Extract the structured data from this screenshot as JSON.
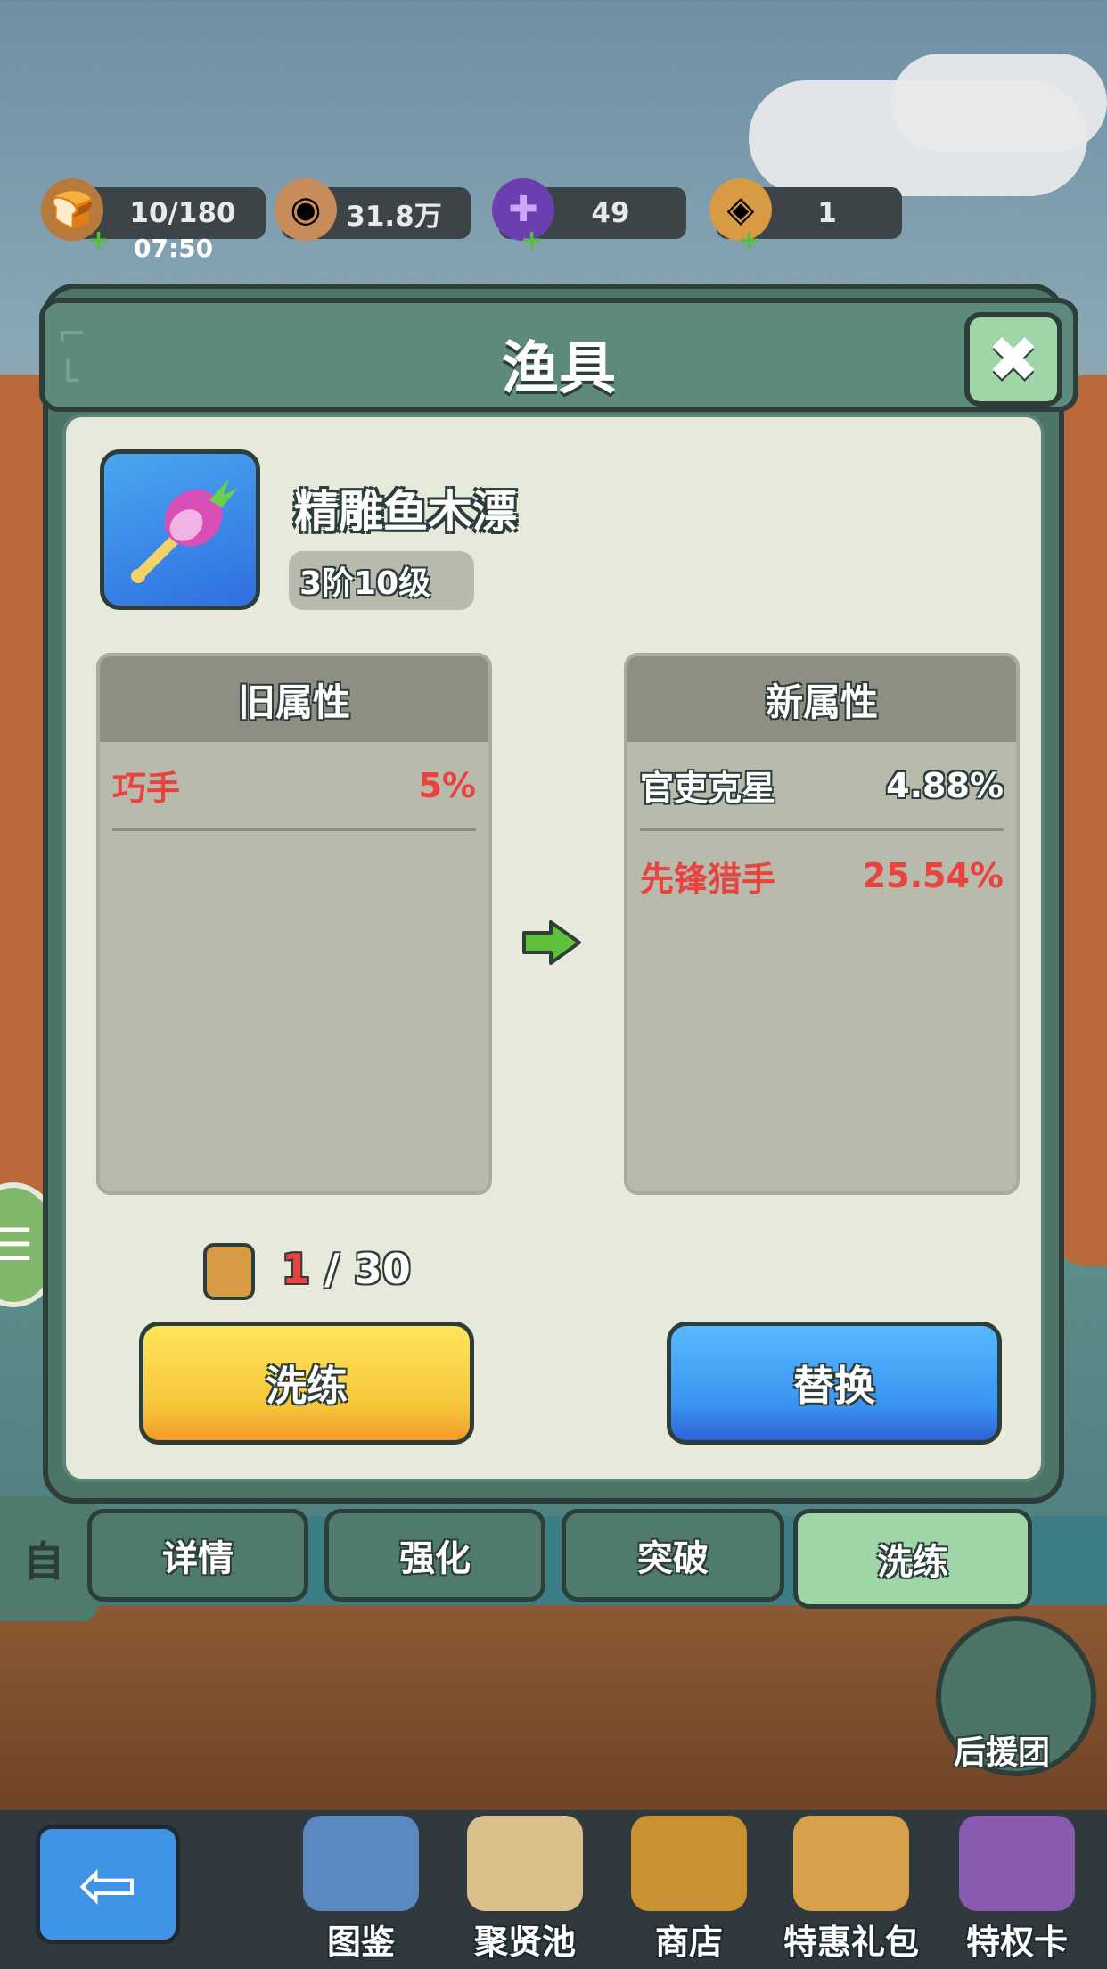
{
  "resources": {
    "stamina": {
      "value": "10/180",
      "timer": "07:50",
      "icon": "bread-icon"
    },
    "coins": {
      "value": "31.8万",
      "icon": "coin-icon"
    },
    "gems": {
      "value": "49",
      "icon": "purple-gem-icon"
    },
    "stones": {
      "value": "1",
      "icon": "refine-stone-icon"
    }
  },
  "dialog": {
    "title": "渔具",
    "close": "✖",
    "item": {
      "name": "精雕鱼木漂",
      "level": "3阶10级",
      "icon": "fishing-float-icon"
    },
    "old_panel": {
      "title": "旧属性",
      "attrs": [
        {
          "name": "巧手",
          "value": "5%",
          "color": "#e8433e"
        }
      ]
    },
    "new_panel": {
      "title": "新属性",
      "attrs": [
        {
          "name": "官吏克星",
          "value": "4.88%",
          "color": "#ffffff"
        },
        {
          "name": "先锋猎手",
          "value": "25.54%",
          "color": "#e8433e"
        }
      ]
    },
    "cost": {
      "current": "1",
      "separator": " / ",
      "total": "30",
      "icon": "refine-stone-icon"
    },
    "refine_button": "洗练",
    "replace_button": "替换"
  },
  "tabs": [
    "详情",
    "强化",
    "突破",
    "洗练"
  ],
  "side": {
    "auto_label": "自",
    "menu_icon": "hamburger-menu-icon"
  },
  "support": {
    "label": "后援团",
    "icon": "temple-icon"
  },
  "bottom_nav": {
    "back_icon": "back-arrow-icon",
    "items": [
      "图鉴",
      "聚贤池",
      "商店",
      "特惠礼包",
      "特权卡"
    ]
  },
  "colors": {
    "accent_green": "#4c7467",
    "stat_red": "#e8433e",
    "button_yellow": "#f6c63a",
    "button_blue": "#3a94f0"
  }
}
